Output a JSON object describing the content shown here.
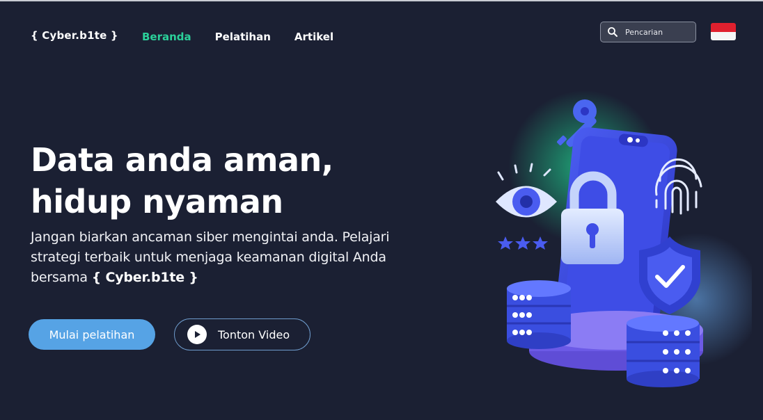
{
  "brand": {
    "logo": "{ Cyber.b1te }"
  },
  "nav": {
    "items": [
      {
        "label": "Beranda",
        "active": true
      },
      {
        "label": "Pelatihan",
        "active": false
      },
      {
        "label": "Artikel",
        "active": false
      }
    ]
  },
  "search": {
    "placeholder": "Pencarian",
    "icon": "search-icon"
  },
  "language": {
    "flag": "indonesia-flag-icon",
    "colors": [
      "#e0202e",
      "#f5f5f5"
    ]
  },
  "hero": {
    "title_line1": "Data anda aman,",
    "title_line2": "hidup nyaman",
    "subtitle_text": "Jangan biarkan ancaman siber mengintai anda. Pelajari strategi terbaik untuk menjaga keamanan digital Anda bersama",
    "subtitle_brand": "{ Cyber.b1te }",
    "primary_button": "Mulai pelatihan",
    "secondary_button": "Tonton Video",
    "secondary_icon": "play-icon"
  },
  "colors": {
    "background": "#1b2033",
    "accent_green": "#2bd09a",
    "primary_blue": "#56a3e5",
    "illustration_blue": "#3d4fe0"
  }
}
